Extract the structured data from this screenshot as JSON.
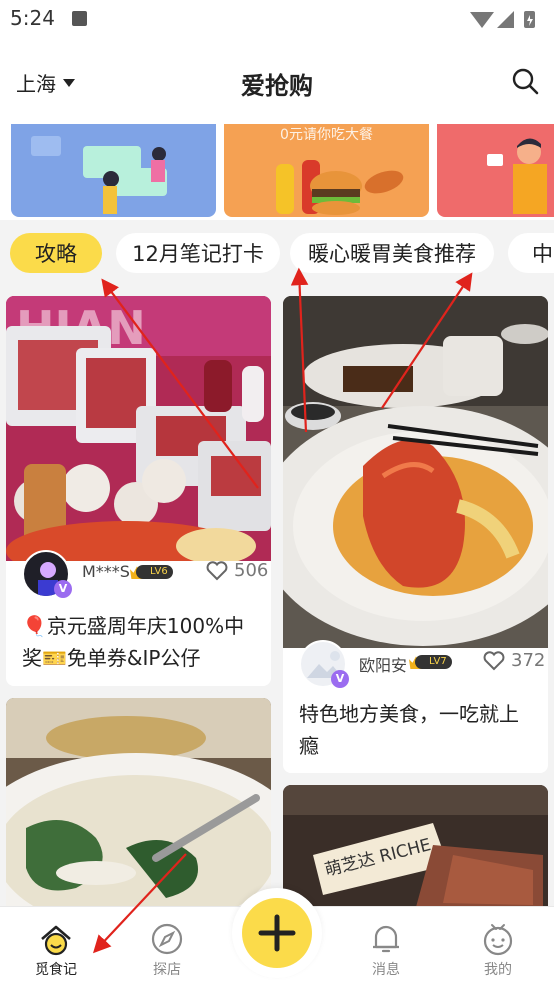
{
  "status_bar": {
    "time": "5:24"
  },
  "header": {
    "city": "上海",
    "title": "爱抢购"
  },
  "banners": [
    {
      "text": ""
    },
    {
      "text": "0元请你吃大餐"
    },
    {
      "text": ""
    }
  ],
  "tags": [
    {
      "label": "攻略",
      "active": true
    },
    {
      "label": "12月笔记打卡",
      "active": false
    },
    {
      "label": "暖心暖胃美食推荐",
      "active": false
    },
    {
      "label": "中",
      "active": false
    }
  ],
  "feed": [
    {
      "author": "M***S",
      "level": "LV6",
      "likes": "506",
      "title": "🎈京元盛周年庆100%中奖🎫免单券&IP公仔"
    },
    {
      "author": "欧阳安",
      "level": "LV7",
      "likes": "372",
      "title": "特色地方美食，一吃就上瘾"
    },
    {
      "author": "",
      "level": "",
      "likes": "",
      "title": ""
    },
    {
      "author": "",
      "level": "",
      "likes": "",
      "title": ""
    }
  ],
  "photo_text": {
    "sign": "萌芝达 RICHE"
  },
  "bottom_nav": [
    {
      "label": "觅食记",
      "active": true
    },
    {
      "label": "探店",
      "active": false
    },
    {
      "label": "消息",
      "active": false
    },
    {
      "label": "我的",
      "active": false
    }
  ],
  "colors": {
    "accent": "#fbdb4a",
    "arrow": "#e0231c",
    "vip": "#9b6cf0"
  }
}
